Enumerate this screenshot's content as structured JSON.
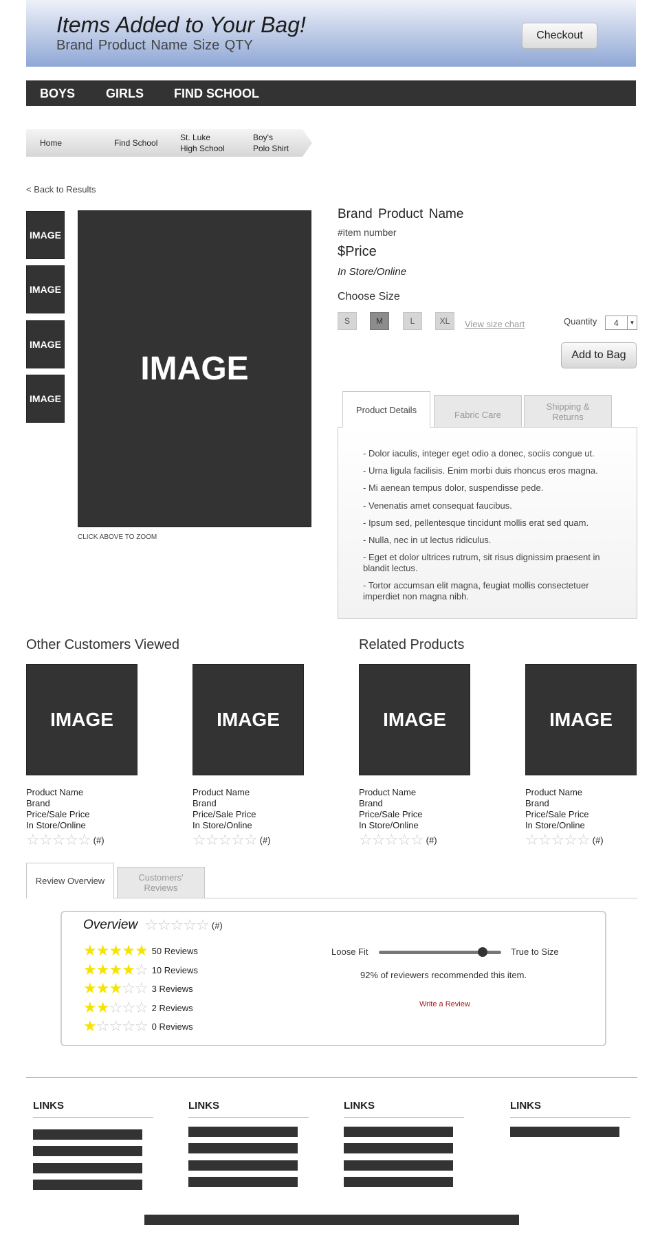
{
  "banner": {
    "title": "Items Added to Your Bag!",
    "subtitle": "Brand  Product Name  Size  QTY",
    "checkout_label": "Checkout"
  },
  "nav": {
    "items": [
      "BOYS",
      "GIRLS",
      "FIND SCHOOL"
    ]
  },
  "breadcrumb": [
    "Home",
    "Find School",
    "St. Luke\nHigh School",
    "Boy's\nPolo Shirt"
  ],
  "back_link": "< Back to Results",
  "gallery": {
    "thumbs": [
      "IMAGE",
      "IMAGE",
      "IMAGE",
      "IMAGE"
    ],
    "main": "IMAGE",
    "zoom_hint": "CLICK ABOVE TO ZOOM"
  },
  "product": {
    "name": "Brand  Product Name",
    "item_number": "#item number",
    "price": "$Price",
    "availability": "In Store/Online",
    "choose_size_label": "Choose Size",
    "sizes": [
      "S",
      "M",
      "L",
      "XL"
    ],
    "selected_size": "M",
    "size_chart_link": "View size chart",
    "quantity_label": "Quantity",
    "quantity_value": "4",
    "add_to_bag_label": "Add to Bag"
  },
  "detail_tabs": {
    "tabs": [
      "Product Details",
      "Fabric Care",
      "Shipping &\nReturns"
    ],
    "active": "Product Details",
    "bullets": [
      "- Dolor iaculis, integer eget odio a donec, sociis congue ut.",
      "- Urna ligula facilisis. Enim morbi duis rhoncus eros magna.",
      "- Mi aenean tempus dolor, suspendisse pede.",
      "- Venenatis amet consequat faucibus.",
      "- Ipsum sed, pellentesque tincidunt mollis erat sed quam.",
      "- Nulla, nec in ut lectus ridiculus.",
      "- Eget et dolor ultrices rutrum, sit risus dignissim praesent in blandit lectus.",
      "- Tortor accumsan elit magna, feugiat mollis consectetuer imperdiet non magna nibh."
    ]
  },
  "sections": {
    "other_viewed_title": "Other Customers Viewed",
    "related_title": "Related Products"
  },
  "cards": [
    {
      "image": "IMAGE",
      "name": "Product Name",
      "brand": "Brand",
      "price": "Price/Sale Price",
      "availability": "In Store/Online",
      "rating": 0,
      "count": "(#)"
    },
    {
      "image": "IMAGE",
      "name": "Product Name",
      "brand": "Brand",
      "price": "Price/Sale Price",
      "availability": "In Store/Online",
      "rating": 0,
      "count": "(#)"
    },
    {
      "image": "IMAGE",
      "name": "Product Name",
      "brand": "Brand",
      "price": "Price/Sale Price",
      "availability": "In Store/Online",
      "rating": 0,
      "count": "(#)"
    },
    {
      "image": "IMAGE",
      "name": "Product Name",
      "brand": "Brand",
      "price": "Price/Sale Price",
      "availability": "In Store/Online",
      "rating": 0,
      "count": "(#)"
    }
  ],
  "review_tabs": {
    "tabs": [
      "Review Overview",
      "Customers'\nReviews"
    ],
    "active": "Review Overview"
  },
  "overview": {
    "title": "Overview",
    "overall_rating": 0,
    "overall_count": "(#)",
    "breakdown": [
      {
        "stars": 5,
        "label": "50 Reviews"
      },
      {
        "stars": 4,
        "label": "10 Reviews"
      },
      {
        "stars": 3,
        "label": "3 Reviews"
      },
      {
        "stars": 2,
        "label": "2 Reviews"
      },
      {
        "stars": 1,
        "label": "0 Reviews"
      }
    ],
    "fit_left": "Loose Fit",
    "fit_right": "True to Size",
    "fit_value": 0.85,
    "recommend_text": "92% of reviewers recommended this item.",
    "write_review": "Write a Review"
  },
  "footer": {
    "columns": [
      {
        "title": "LINKS",
        "link_count": 4
      },
      {
        "title": "LINKS",
        "link_count": 4
      },
      {
        "title": "LINKS",
        "link_count": 4
      },
      {
        "title": "LINKS",
        "link_count": 1
      }
    ]
  },
  "colors": {
    "banner_top": "#eef1f8",
    "banner_bottom": "#8fa7d6",
    "nav_bg": "#333333",
    "star_on": "#f5e400",
    "write_review": "#a02020"
  }
}
